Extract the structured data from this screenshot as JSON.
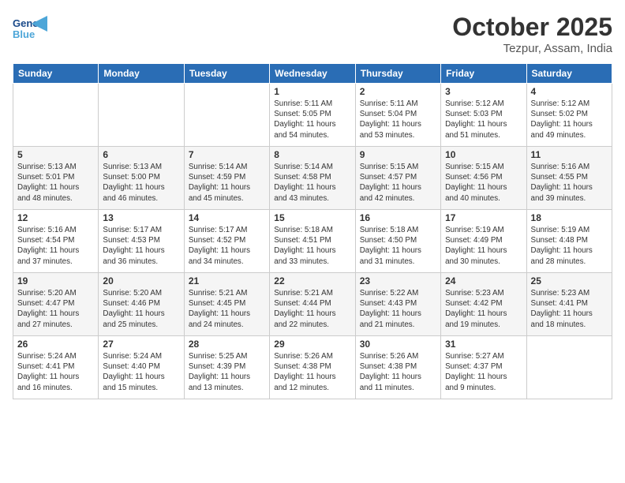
{
  "header": {
    "logo_line1": "General",
    "logo_line2": "Blue",
    "month_title": "October 2025",
    "location": "Tezpur, Assam, India"
  },
  "days_of_week": [
    "Sunday",
    "Monday",
    "Tuesday",
    "Wednesday",
    "Thursday",
    "Friday",
    "Saturday"
  ],
  "weeks": [
    [
      {
        "day": "",
        "info": ""
      },
      {
        "day": "",
        "info": ""
      },
      {
        "day": "",
        "info": ""
      },
      {
        "day": "1",
        "info": "Sunrise: 5:11 AM\nSunset: 5:05 PM\nDaylight: 11 hours\nand 54 minutes."
      },
      {
        "day": "2",
        "info": "Sunrise: 5:11 AM\nSunset: 5:04 PM\nDaylight: 11 hours\nand 53 minutes."
      },
      {
        "day": "3",
        "info": "Sunrise: 5:12 AM\nSunset: 5:03 PM\nDaylight: 11 hours\nand 51 minutes."
      },
      {
        "day": "4",
        "info": "Sunrise: 5:12 AM\nSunset: 5:02 PM\nDaylight: 11 hours\nand 49 minutes."
      }
    ],
    [
      {
        "day": "5",
        "info": "Sunrise: 5:13 AM\nSunset: 5:01 PM\nDaylight: 11 hours\nand 48 minutes."
      },
      {
        "day": "6",
        "info": "Sunrise: 5:13 AM\nSunset: 5:00 PM\nDaylight: 11 hours\nand 46 minutes."
      },
      {
        "day": "7",
        "info": "Sunrise: 5:14 AM\nSunset: 4:59 PM\nDaylight: 11 hours\nand 45 minutes."
      },
      {
        "day": "8",
        "info": "Sunrise: 5:14 AM\nSunset: 4:58 PM\nDaylight: 11 hours\nand 43 minutes."
      },
      {
        "day": "9",
        "info": "Sunrise: 5:15 AM\nSunset: 4:57 PM\nDaylight: 11 hours\nand 42 minutes."
      },
      {
        "day": "10",
        "info": "Sunrise: 5:15 AM\nSunset: 4:56 PM\nDaylight: 11 hours\nand 40 minutes."
      },
      {
        "day": "11",
        "info": "Sunrise: 5:16 AM\nSunset: 4:55 PM\nDaylight: 11 hours\nand 39 minutes."
      }
    ],
    [
      {
        "day": "12",
        "info": "Sunrise: 5:16 AM\nSunset: 4:54 PM\nDaylight: 11 hours\nand 37 minutes."
      },
      {
        "day": "13",
        "info": "Sunrise: 5:17 AM\nSunset: 4:53 PM\nDaylight: 11 hours\nand 36 minutes."
      },
      {
        "day": "14",
        "info": "Sunrise: 5:17 AM\nSunset: 4:52 PM\nDaylight: 11 hours\nand 34 minutes."
      },
      {
        "day": "15",
        "info": "Sunrise: 5:18 AM\nSunset: 4:51 PM\nDaylight: 11 hours\nand 33 minutes."
      },
      {
        "day": "16",
        "info": "Sunrise: 5:18 AM\nSunset: 4:50 PM\nDaylight: 11 hours\nand 31 minutes."
      },
      {
        "day": "17",
        "info": "Sunrise: 5:19 AM\nSunset: 4:49 PM\nDaylight: 11 hours\nand 30 minutes."
      },
      {
        "day": "18",
        "info": "Sunrise: 5:19 AM\nSunset: 4:48 PM\nDaylight: 11 hours\nand 28 minutes."
      }
    ],
    [
      {
        "day": "19",
        "info": "Sunrise: 5:20 AM\nSunset: 4:47 PM\nDaylight: 11 hours\nand 27 minutes."
      },
      {
        "day": "20",
        "info": "Sunrise: 5:20 AM\nSunset: 4:46 PM\nDaylight: 11 hours\nand 25 minutes."
      },
      {
        "day": "21",
        "info": "Sunrise: 5:21 AM\nSunset: 4:45 PM\nDaylight: 11 hours\nand 24 minutes."
      },
      {
        "day": "22",
        "info": "Sunrise: 5:21 AM\nSunset: 4:44 PM\nDaylight: 11 hours\nand 22 minutes."
      },
      {
        "day": "23",
        "info": "Sunrise: 5:22 AM\nSunset: 4:43 PM\nDaylight: 11 hours\nand 21 minutes."
      },
      {
        "day": "24",
        "info": "Sunrise: 5:23 AM\nSunset: 4:42 PM\nDaylight: 11 hours\nand 19 minutes."
      },
      {
        "day": "25",
        "info": "Sunrise: 5:23 AM\nSunset: 4:41 PM\nDaylight: 11 hours\nand 18 minutes."
      }
    ],
    [
      {
        "day": "26",
        "info": "Sunrise: 5:24 AM\nSunset: 4:41 PM\nDaylight: 11 hours\nand 16 minutes."
      },
      {
        "day": "27",
        "info": "Sunrise: 5:24 AM\nSunset: 4:40 PM\nDaylight: 11 hours\nand 15 minutes."
      },
      {
        "day": "28",
        "info": "Sunrise: 5:25 AM\nSunset: 4:39 PM\nDaylight: 11 hours\nand 13 minutes."
      },
      {
        "day": "29",
        "info": "Sunrise: 5:26 AM\nSunset: 4:38 PM\nDaylight: 11 hours\nand 12 minutes."
      },
      {
        "day": "30",
        "info": "Sunrise: 5:26 AM\nSunset: 4:38 PM\nDaylight: 11 hours\nand 11 minutes."
      },
      {
        "day": "31",
        "info": "Sunrise: 5:27 AM\nSunset: 4:37 PM\nDaylight: 11 hours\nand 9 minutes."
      },
      {
        "day": "",
        "info": ""
      }
    ]
  ]
}
